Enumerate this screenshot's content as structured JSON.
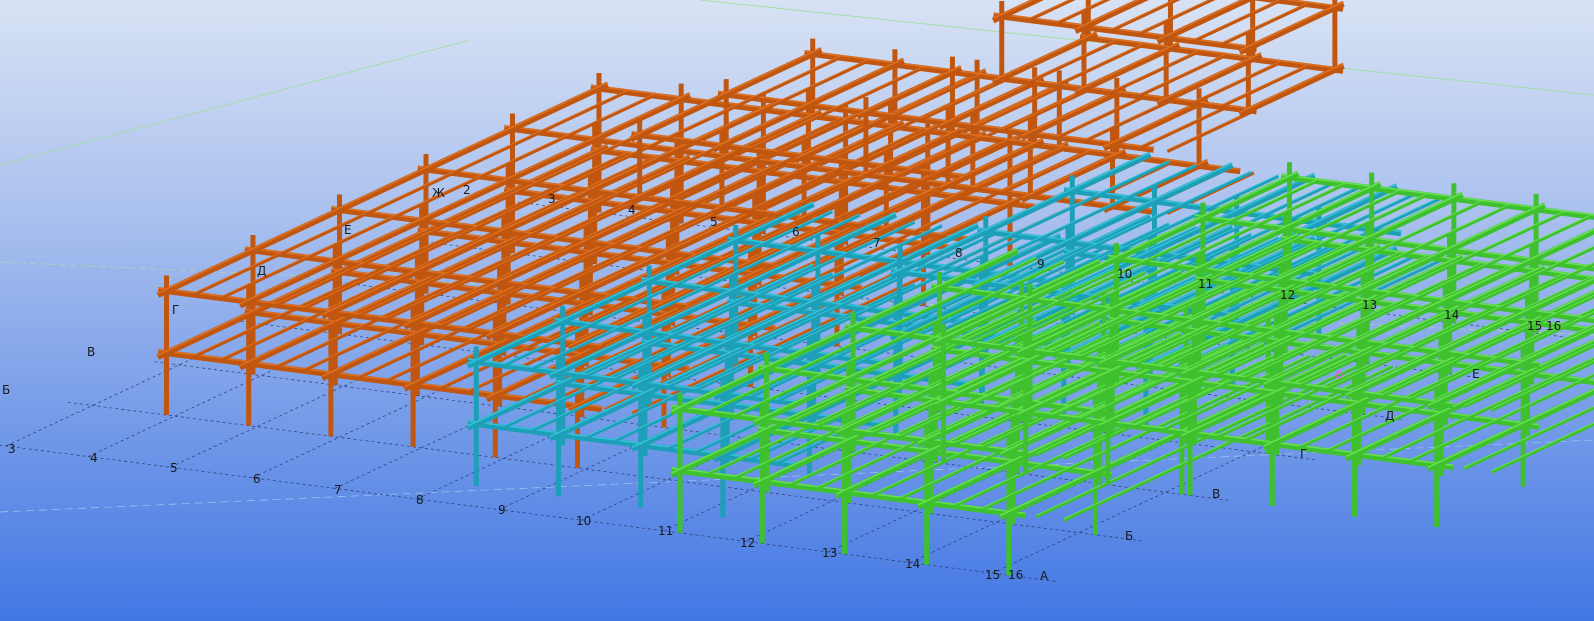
{
  "viewport": {
    "background_top": "#cfdaf0",
    "background_bottom": "#4a7de0"
  },
  "colors": {
    "block_orange": "#c0560f",
    "block_orange_light": "#dd7020",
    "block_cyan": "#1e9fb8",
    "block_cyan_light": "#35c1d8",
    "block_green": "#3fc02e",
    "block_green_light": "#66e050",
    "grid_line": "#2a3a70",
    "guide_line": "#9be09b",
    "marker": "#ff40ff"
  },
  "axis_labels_front": [
    "3",
    "4",
    "5",
    "6",
    "7",
    "8",
    "9",
    "10",
    "11",
    "12",
    "13",
    "14",
    "15",
    "16"
  ],
  "axis_labels_front_bottom": [
    "Б",
    "В",
    "Г",
    "Д",
    "Е"
  ],
  "labels": {
    "left_b": "Б",
    "end_a": "А",
    "right_b": "Б",
    "right_v": "В",
    "right_g": "Г",
    "right_d": "Д",
    "right_e": "Е",
    "right_15": "15",
    "right_16": "16",
    "on_model": [
      "Ж",
      "2",
      "3",
      "4",
      "5",
      "6",
      "7",
      "8",
      "9",
      "10",
      "11",
      "12",
      "13",
      "14"
    ],
    "left_model": [
      "Е",
      "Д",
      "Г",
      "В"
    ]
  }
}
